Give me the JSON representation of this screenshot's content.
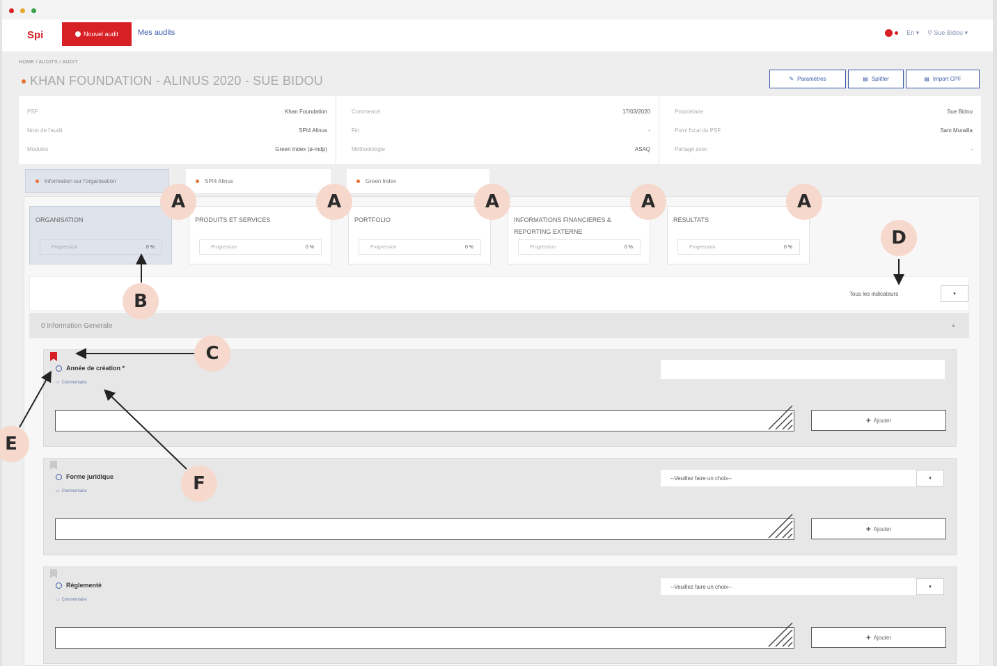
{
  "window": {
    "traffic_colors": [
      "#d71f26",
      "#e8a92b",
      "#3aa34a"
    ]
  },
  "nav": {
    "logo": "Spi",
    "new_audit": "Nouvel audit",
    "my_audits": "Mes audits",
    "lang": "En",
    "user": "Sue Bidou"
  },
  "breadcrumb": "HOME / AUDITS / AUDIT",
  "title": "KHAN FOUNDATION - ALINUS 2020 - SUE BIDOU",
  "header_buttons": {
    "params": "Paramètres",
    "split": "Splitter",
    "import": "Import CPF"
  },
  "info": {
    "col1": [
      {
        "label": "PSF",
        "value": "Khan Foundation"
      },
      {
        "label": "Nom de l'audit",
        "value": "SPI4 Alinus"
      },
      {
        "label": "Modules",
        "value": "Green Index (ø-mdp)"
      }
    ],
    "col2": [
      {
        "label": "Commencé",
        "value": "17/03/2020"
      },
      {
        "label": "Fin",
        "value": "-"
      },
      {
        "label": "Méthodologie",
        "value": "ASAQ"
      }
    ],
    "col3": [
      {
        "label": "Propriétaire",
        "value": "Sue Bidou"
      },
      {
        "label": "Point focal du PSF",
        "value": "Sam Murailla"
      },
      {
        "label": "Partagé avec",
        "value": "-"
      }
    ]
  },
  "module_tabs": [
    "Information sur l'organisation",
    "SPI4 Alinus",
    "Green Index"
  ],
  "categories": [
    {
      "name": "ORGANISATION",
      "progress_label": "Progression",
      "progress": "0 %"
    },
    {
      "name": "PRODUITS ET SERVICES",
      "progress_label": "Progression",
      "progress": "0 %"
    },
    {
      "name": "PORTFOLIO",
      "progress_label": "Progression",
      "progress": "0 %"
    },
    {
      "name": "INFORMATIONS FINANCIERES & REPORTING EXTERNE",
      "progress_label": "Progression",
      "progress": "0 %"
    },
    {
      "name": "RESULTATS",
      "progress_label": "Progression",
      "progress": "0 %"
    }
  ],
  "filter": {
    "value": "Tous les indicateurs",
    "button": "▾"
  },
  "section": {
    "title": "0 Information Generale",
    "caret": "▴"
  },
  "questions": [
    {
      "label": "Année de création *",
      "comment": "Commentaire",
      "add": "Ajouter",
      "control": "input",
      "bookmark_color": "#d71f26"
    },
    {
      "label": "Forme juridique",
      "comment": "Commentaire",
      "add": "Ajouter",
      "control": "select",
      "select_value": "--Veuillez faire un choix--",
      "bookmark_color": "#c9c9c9"
    },
    {
      "label": "Réglementé",
      "comment": "Commentaire",
      "add": "Ajouter",
      "control": "select",
      "select_value": "--Veuillez faire un choix--",
      "bookmark_color": "#c9c9c9"
    }
  ],
  "annotations": {
    "A": "A",
    "B": "B",
    "C": "C",
    "D": "D",
    "E": "E",
    "F": "F"
  },
  "colors": {
    "accent_red": "#d71f26",
    "link_blue": "#3a58a8",
    "marker_bg": "#f6d8cd",
    "orange_dot": "#e57131"
  }
}
